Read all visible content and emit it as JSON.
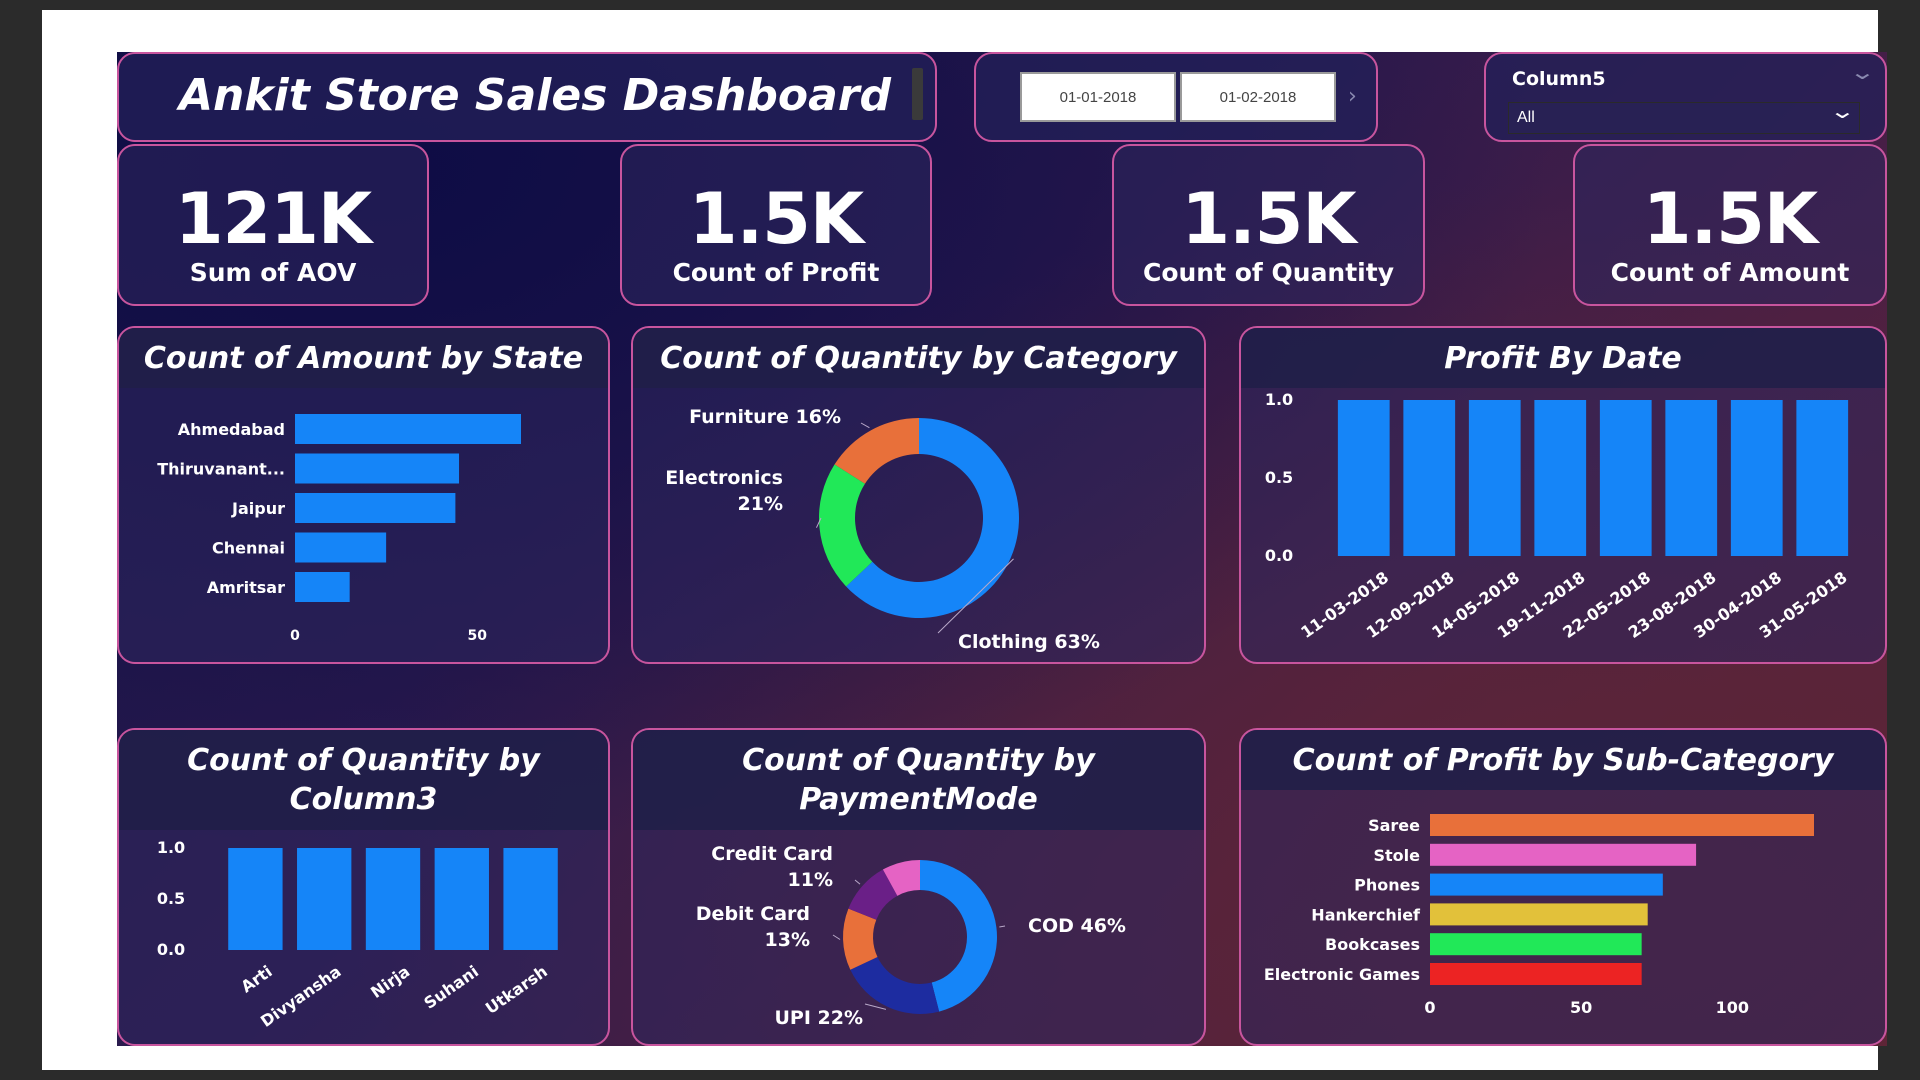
{
  "title": "Ankit Store Sales Dashboard",
  "date_filter": {
    "start": "01-01-2018",
    "end": "01-02-2018"
  },
  "slicer": {
    "label": "Column5",
    "value": "All"
  },
  "kpis": [
    {
      "value": "121K",
      "label": "Sum of AOV"
    },
    {
      "value": "1.5K",
      "label": "Count of Profit"
    },
    {
      "value": "1.5K",
      "label": "Count of Quantity"
    },
    {
      "value": "1.5K",
      "label": "Count of Amount"
    }
  ],
  "panels": {
    "state": "Count of Amount by State",
    "category": "Count of Quantity by Category",
    "date": "Profit By Date",
    "column3_line1": "Count of Quantity by",
    "column3_line2": "Column3",
    "payment_line1": "Count of Quantity by",
    "payment_line2": "PaymentMode",
    "subcat": "Count of Profit by Sub-Category"
  },
  "colors": {
    "accent_blue": "#1585f8",
    "panel_border": "#c8559e",
    "orange": "#e8703a",
    "green": "#21e858",
    "pink": "#e563c4",
    "yellow": "#e2c13a",
    "red": "#ec2323",
    "purple": "#6a1f87",
    "navy": "#1d2ca0"
  },
  "chart_data": [
    {
      "type": "bar",
      "orientation": "horizontal",
      "categories": [
        "Ahmedabad",
        "Thiruvanant...",
        "Jaipur",
        "Chennai",
        "Amritsar"
      ],
      "values": [
        62,
        45,
        44,
        25,
        15
      ],
      "xlim": [
        0,
        62
      ],
      "xticks": [
        0,
        50
      ],
      "color": "#1585f8"
    },
    {
      "type": "pie",
      "donut": true,
      "slices": [
        {
          "label": "Clothing 63%",
          "value": 63,
          "color": "#1585f8"
        },
        {
          "label": "Electronics 21%",
          "label_lines": [
            "Electronics",
            "21%"
          ],
          "value": 21,
          "color": "#21e858"
        },
        {
          "label": "Furniture 16%",
          "value": 16,
          "color": "#e8703a"
        }
      ]
    },
    {
      "type": "bar",
      "categories": [
        "11-03-2018",
        "12-09-2018",
        "14-05-2018",
        "19-11-2018",
        "22-05-2018",
        "23-08-2018",
        "30-04-2018",
        "31-05-2018"
      ],
      "values": [
        1,
        1,
        1,
        1,
        1,
        1,
        1,
        1
      ],
      "ylim": [
        0,
        1
      ],
      "yticks": [
        "1.0",
        "0.5",
        "0.0"
      ],
      "color": "#1585f8"
    },
    {
      "type": "bar",
      "categories": [
        "Arti",
        "Divyansha",
        "Nirja",
        "Suhani",
        "Utkarsh"
      ],
      "values": [
        1,
        1,
        1,
        1,
        1
      ],
      "ylim": [
        0,
        1
      ],
      "yticks": [
        "1.0",
        "0.5",
        "0.0"
      ],
      "color": "#1585f8"
    },
    {
      "type": "pie",
      "donut": true,
      "slices": [
        {
          "label": "COD 46%",
          "value": 46,
          "color": "#1585f8"
        },
        {
          "label": "UPI 22%",
          "value": 22,
          "color": "#1d2ca0"
        },
        {
          "label": "Debit Card 13%",
          "label_lines": [
            "Debit Card",
            "13%"
          ],
          "value": 13,
          "color": "#e8703a"
        },
        {
          "label": "Credit Card 11%",
          "label_lines": [
            "Credit Card",
            "11%"
          ],
          "value": 11,
          "color": "#6a1f87"
        },
        {
          "label": "",
          "value": 8,
          "color": "#e563c4"
        }
      ]
    },
    {
      "type": "bar",
      "orientation": "horizontal",
      "categories": [
        "Saree",
        "Stole",
        "Phones",
        "Hankerchief",
        "Bookcases",
        "Electronic Games"
      ],
      "values": [
        127,
        88,
        77,
        72,
        70,
        70
      ],
      "colors": [
        "#e8703a",
        "#e563c4",
        "#1585f8",
        "#e2c13a",
        "#21e858",
        "#ec2323"
      ],
      "xlim": [
        0,
        127
      ],
      "xticks": [
        0,
        50,
        100
      ]
    }
  ]
}
